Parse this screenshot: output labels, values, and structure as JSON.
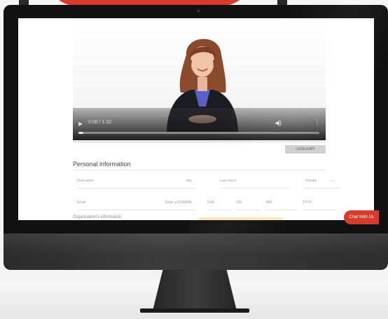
{
  "video": {
    "time": "0:00 / 1:32",
    "progress": 0.02
  },
  "form": {
    "button_label": "CATEGORY",
    "section_title": "Personal information",
    "section2_title": "Organisation's information",
    "row1": {
      "first_name": "First name",
      "first_name_req": "req",
      "last_name": "Last name",
      "gender": "Gender",
      "gender_value": "—"
    },
    "row2": {
      "email": "Email",
      "email_domain": "Enter a DOMAIN",
      "dob_label": "DoB",
      "dob_dd": "DD",
      "dob_mm": "MM",
      "dob_yyyy": "YYYY"
    }
  },
  "chat": {
    "label": "Chat With Us"
  },
  "colors": {
    "accent": "#d63b2b",
    "bezel": "#111111"
  }
}
